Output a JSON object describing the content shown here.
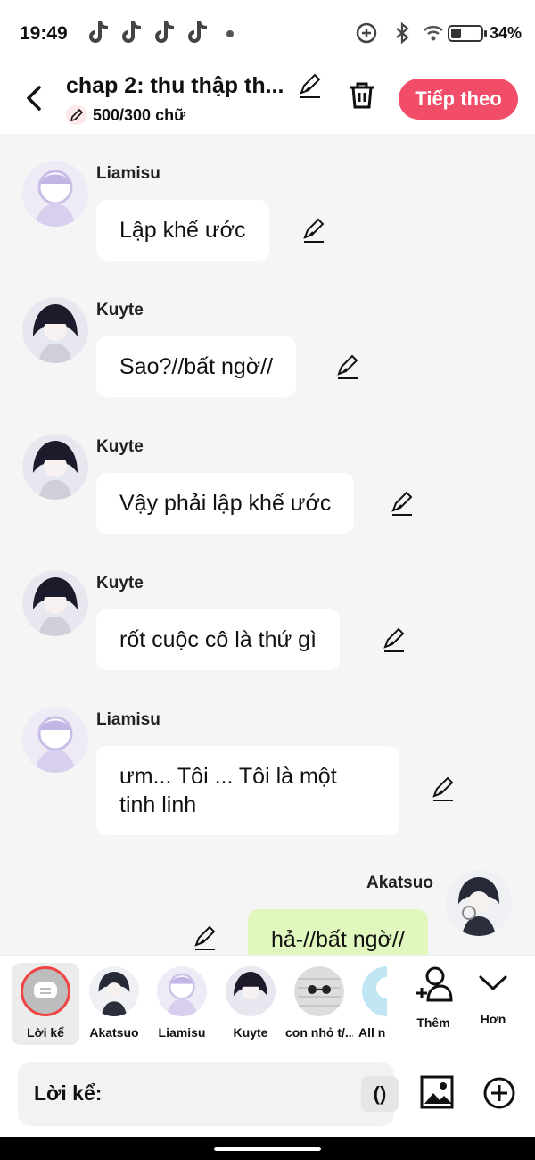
{
  "status_bar": {
    "time": "19:49",
    "battery": "34%",
    "battery_level": 0.34,
    "icons": [
      "tiktok-icon",
      "tiktok-icon",
      "tiktok-icon",
      "tiktok-icon",
      "data-saver-icon",
      "bluetooth-icon",
      "wifi-icon",
      "battery-icon"
    ]
  },
  "header": {
    "title": "chap 2: thu thập th...",
    "word_count": "500/300 chữ",
    "next_label": "Tiếp theo"
  },
  "messages": [
    {
      "sender": "Liamisu",
      "text": "Lập khế ước",
      "side": "left",
      "avatar": "light"
    },
    {
      "sender": "Kuyte",
      "text": "Sao?//bất ngờ//",
      "side": "left",
      "avatar": "dark"
    },
    {
      "sender": "Kuyte",
      "text": "Vậy phải lập khế ước",
      "side": "left",
      "avatar": "dark"
    },
    {
      "sender": "Kuyte",
      "text": "rốt cuộc cô là thứ gì",
      "side": "left",
      "avatar": "dark"
    },
    {
      "sender": "Liamisu",
      "text": "ưm... Tôi ... Tôi là một tinh linh",
      "side": "left",
      "avatar": "light"
    },
    {
      "sender": "Akatsuo",
      "text": "hả-//bất ngờ//",
      "side": "right",
      "avatar": "akatsuo"
    }
  ],
  "characters": [
    {
      "label": "Lời kể",
      "selected": true
    },
    {
      "label": "Akatsuo"
    },
    {
      "label": "Liamisu"
    },
    {
      "label": "Kuyte"
    },
    {
      "label": "con nhỏ t/..."
    },
    {
      "label": "All n"
    }
  ],
  "actions": {
    "more_label": "Thêm",
    "less_label": "Hơn"
  },
  "composer": {
    "label": "Lời kể:",
    "paren": "()",
    "placeholder": ""
  },
  "colors": {
    "accent": "#f24d68",
    "my_bubble": "#e0f7bd",
    "background": "#f5f5f5"
  }
}
